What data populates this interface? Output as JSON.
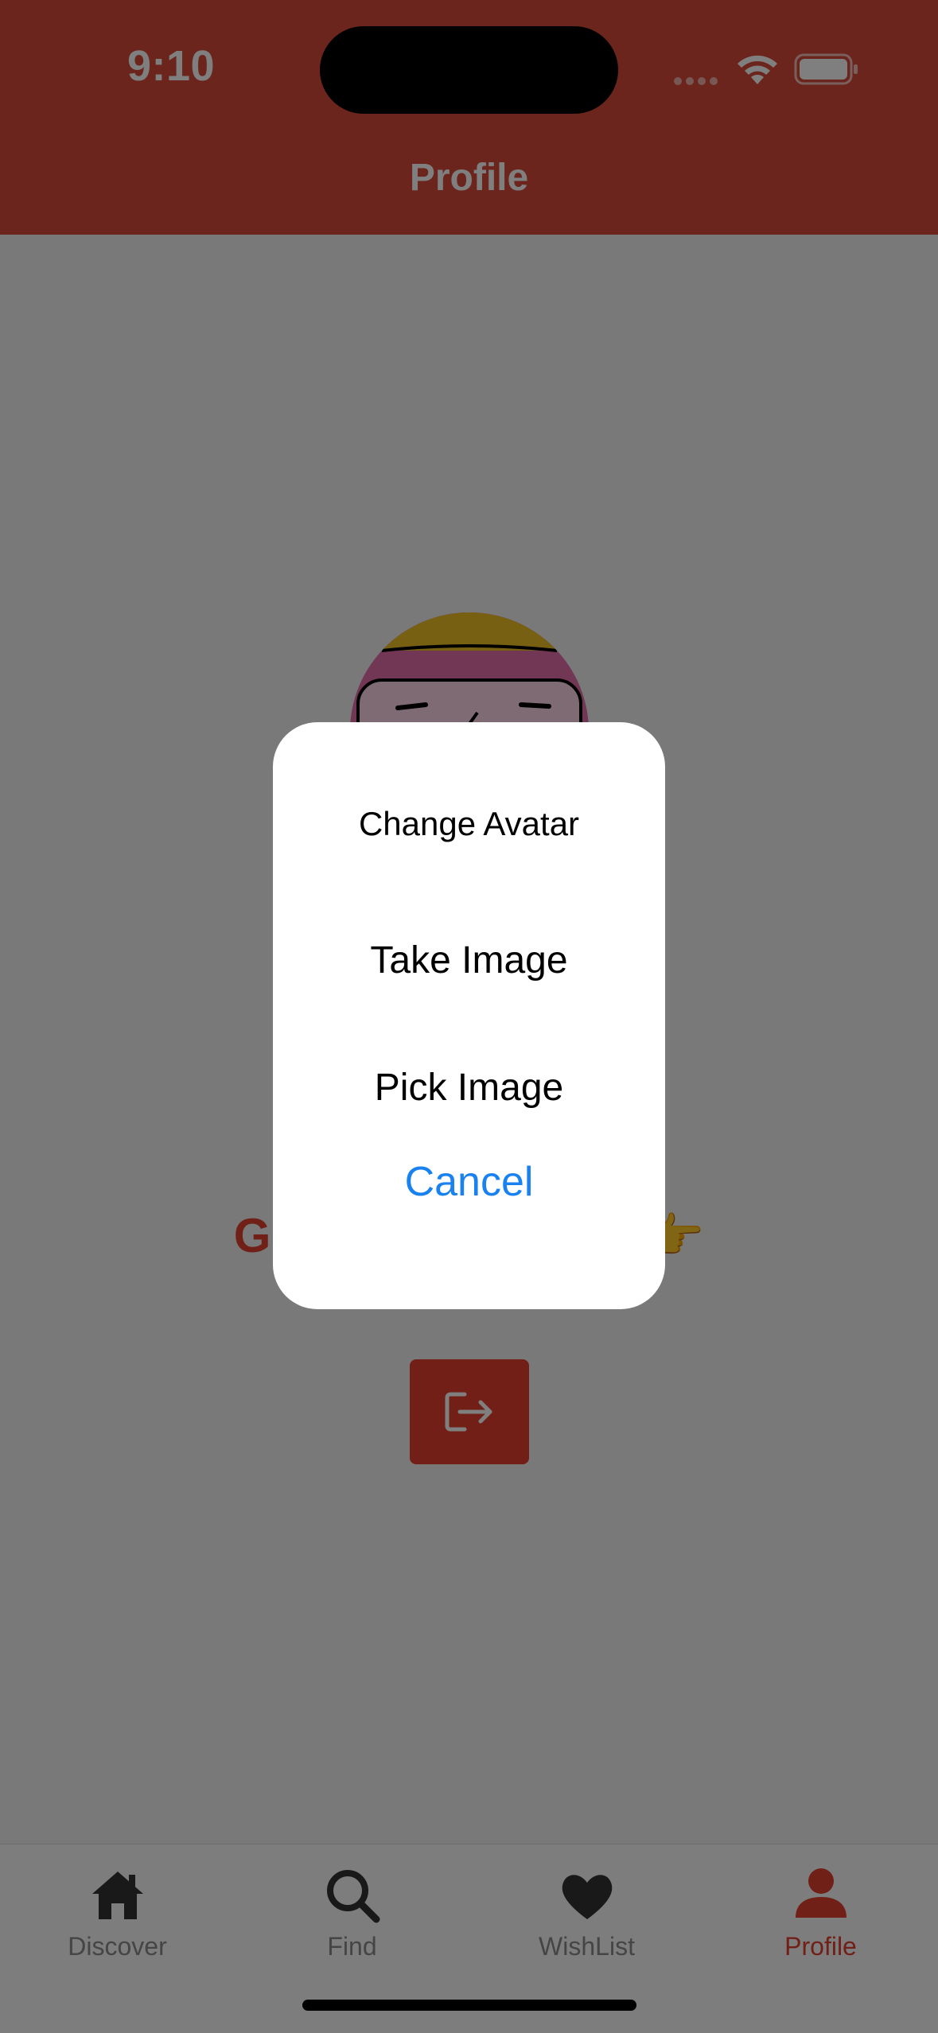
{
  "status_bar": {
    "time": "9:10"
  },
  "header": {
    "title": "Profile"
  },
  "profile": {
    "greeting_start": "G",
    "greeting_emoji": "👉"
  },
  "dialog": {
    "title": "Change Avatar",
    "options": [
      "Take Image",
      "Pick Image"
    ],
    "cancel_label": "Cancel"
  },
  "tabbar": {
    "items": [
      {
        "label": "Discover",
        "icon": "home-icon"
      },
      {
        "label": "Find",
        "icon": "search-icon"
      },
      {
        "label": "WishList",
        "icon": "heart-icon"
      },
      {
        "label": "Profile",
        "icon": "person-icon"
      }
    ],
    "active": "Profile"
  },
  "colors": {
    "accent": "#d84a38",
    "link": "#1a82f0",
    "overlay": "rgba(0,0,0,0.5)"
  }
}
